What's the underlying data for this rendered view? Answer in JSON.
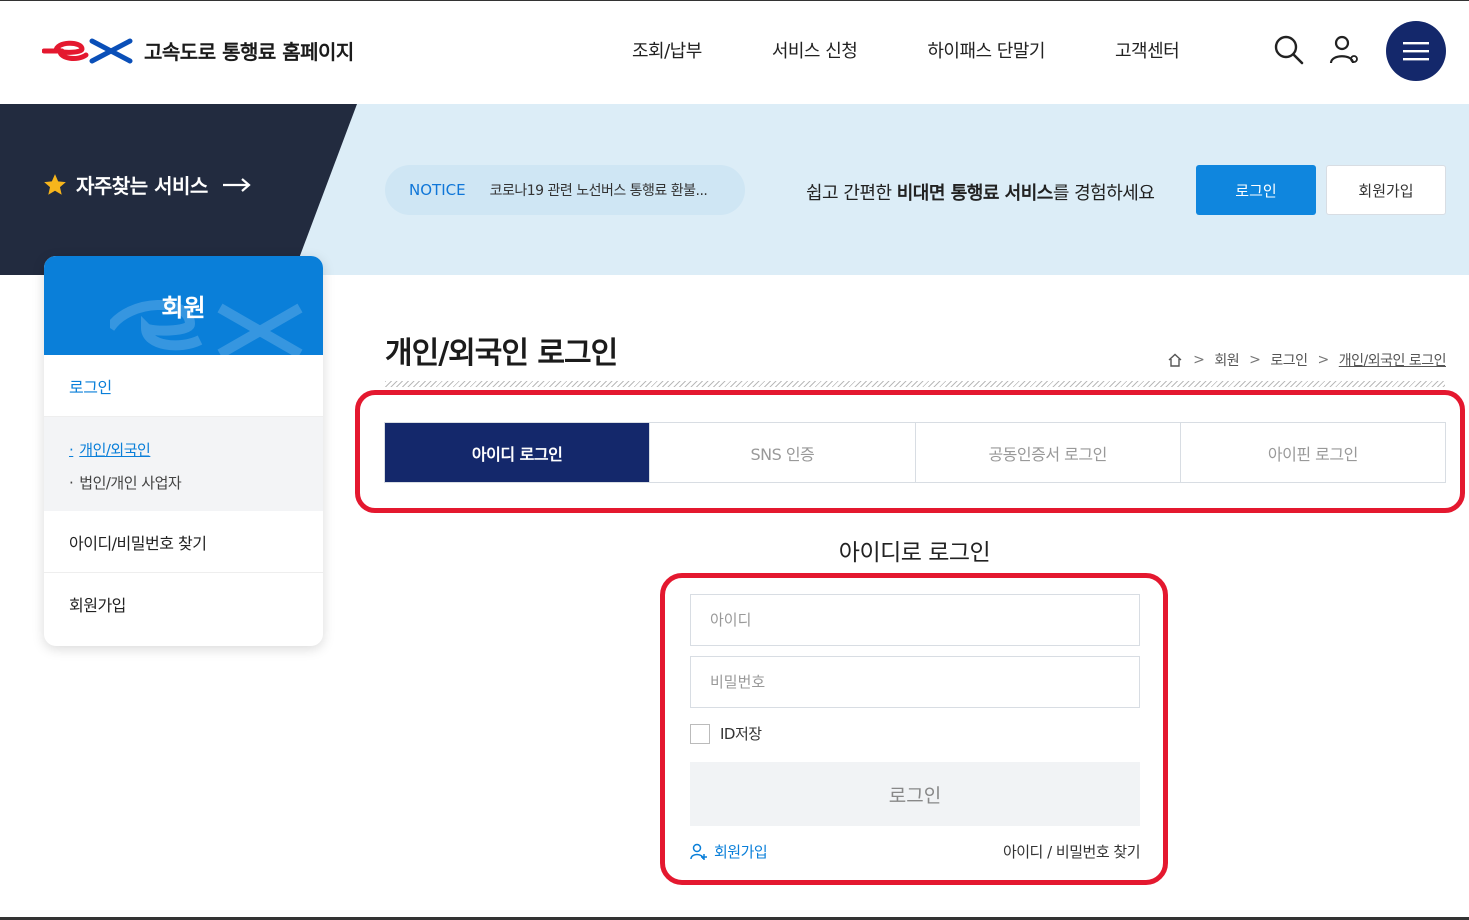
{
  "header": {
    "logo_alt": "ex",
    "site_title": "고속도로 통행료 홈페이지",
    "nav": [
      "조회/납부",
      "서비스 신청",
      "하이패스 단말기",
      "고객센터"
    ],
    "icons": {
      "search": "search-icon",
      "user": "user-icon",
      "menu": "hamburger-icon"
    }
  },
  "banner": {
    "favorites_label": "자주찾는 서비스",
    "notice_label": "NOTICE",
    "notice_text": "코로나19 관련 노선버스 통행료 환불...",
    "promo_prefix": "쉽고 간편한 ",
    "promo_bold": "비대면 통행료 서비스",
    "promo_suffix": "를 경험하세요",
    "login_button": "로그인",
    "join_button": "회원가입"
  },
  "sidebar": {
    "title": "회원",
    "items": [
      {
        "label": "로그인"
      },
      {
        "label": "아이디/비밀번호 찾기"
      },
      {
        "label": "회원가입"
      }
    ],
    "sub_items": [
      {
        "label": "개인/외국인"
      },
      {
        "label": "법인/개인 사업자"
      }
    ]
  },
  "main": {
    "page_title": "개인/외국인 로그인",
    "breadcrumb": [
      "회원",
      "로그인",
      "개인/외국인 로그인"
    ],
    "tabs": [
      {
        "label": "아이디 로그인"
      },
      {
        "label": "SNS 인증"
      },
      {
        "label": "공동인증서 로그인"
      },
      {
        "label": "아이핀 로그인"
      }
    ],
    "form": {
      "title": "아이디로 로그인",
      "id_placeholder": "아이디",
      "pw_placeholder": "비밀번호",
      "save_id_label": "ID저장",
      "login_button": "로그인",
      "join_link": "회원가입",
      "find_link": "아이디 / 비밀번호 찾기"
    }
  },
  "colors": {
    "brand_navy": "#14286b",
    "brand_blue": "#0a7fd9",
    "highlight_red": "#e4182f",
    "banner_bg": "#dcedf7"
  }
}
